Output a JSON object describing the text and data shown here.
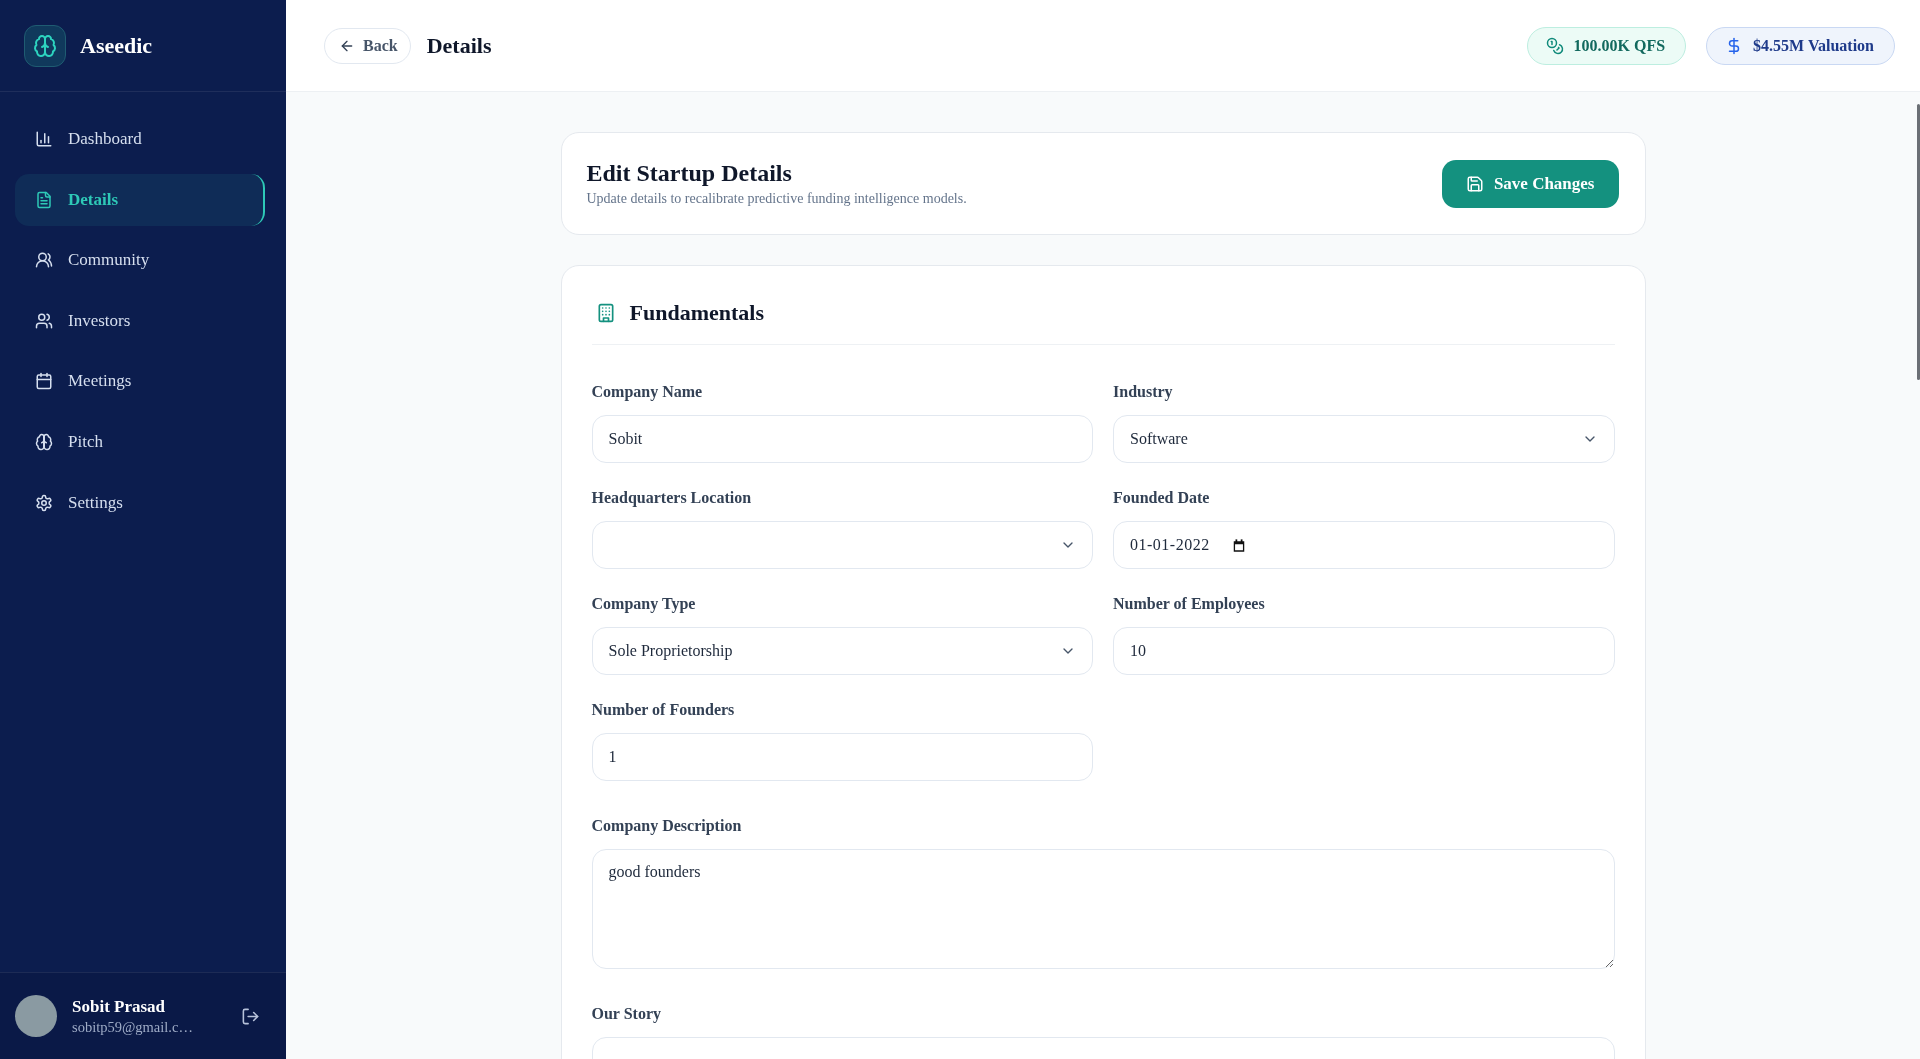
{
  "sidebar": {
    "brand": "Aseedic",
    "nav": [
      {
        "label": "Dashboard",
        "selected": false
      },
      {
        "label": "Details",
        "selected": true
      },
      {
        "label": "Community",
        "selected": false
      },
      {
        "label": "Investors",
        "selected": false
      },
      {
        "label": "Meetings",
        "selected": false
      },
      {
        "label": "Pitch",
        "selected": false
      },
      {
        "label": "Settings",
        "selected": false
      }
    ],
    "user": {
      "name": "Sobit Prasad",
      "email": "sobitp59@gmail.c…"
    }
  },
  "header": {
    "back": "Back",
    "title": "Details",
    "badges": [
      {
        "kind": "score",
        "label": "100.00K QFS"
      },
      {
        "kind": "valuation",
        "label": "$4.55M Valuation"
      }
    ]
  },
  "intro": {
    "title": "Edit Startup Details",
    "subtitle": "Update details to recalibrate predictive funding intelligence models.",
    "button": "Save Changes"
  },
  "section": {
    "title": "Fundamentals",
    "fields": [
      {
        "label": "Company Name",
        "kind": "text",
        "value": "Sobit"
      },
      {
        "label": "Industry",
        "kind": "select",
        "value": "Software"
      },
      {
        "label": "Headquarters Location",
        "kind": "select"
      },
      {
        "label": "Founded Date",
        "kind": "date",
        "value": "01-01-2022"
      },
      {
        "label": "Company Type",
        "kind": "select",
        "value": "Sole Proprietorship"
      },
      {
        "label": "Number of Employees",
        "kind": "text",
        "value": "10"
      },
      {
        "label": "Number of Founders",
        "kind": "text",
        "value": "1"
      },
      {
        "label": "Company Description",
        "kind": "textarea",
        "value": "good founders"
      },
      {
        "label": "Our Story",
        "kind": "textarea"
      }
    ]
  }
}
